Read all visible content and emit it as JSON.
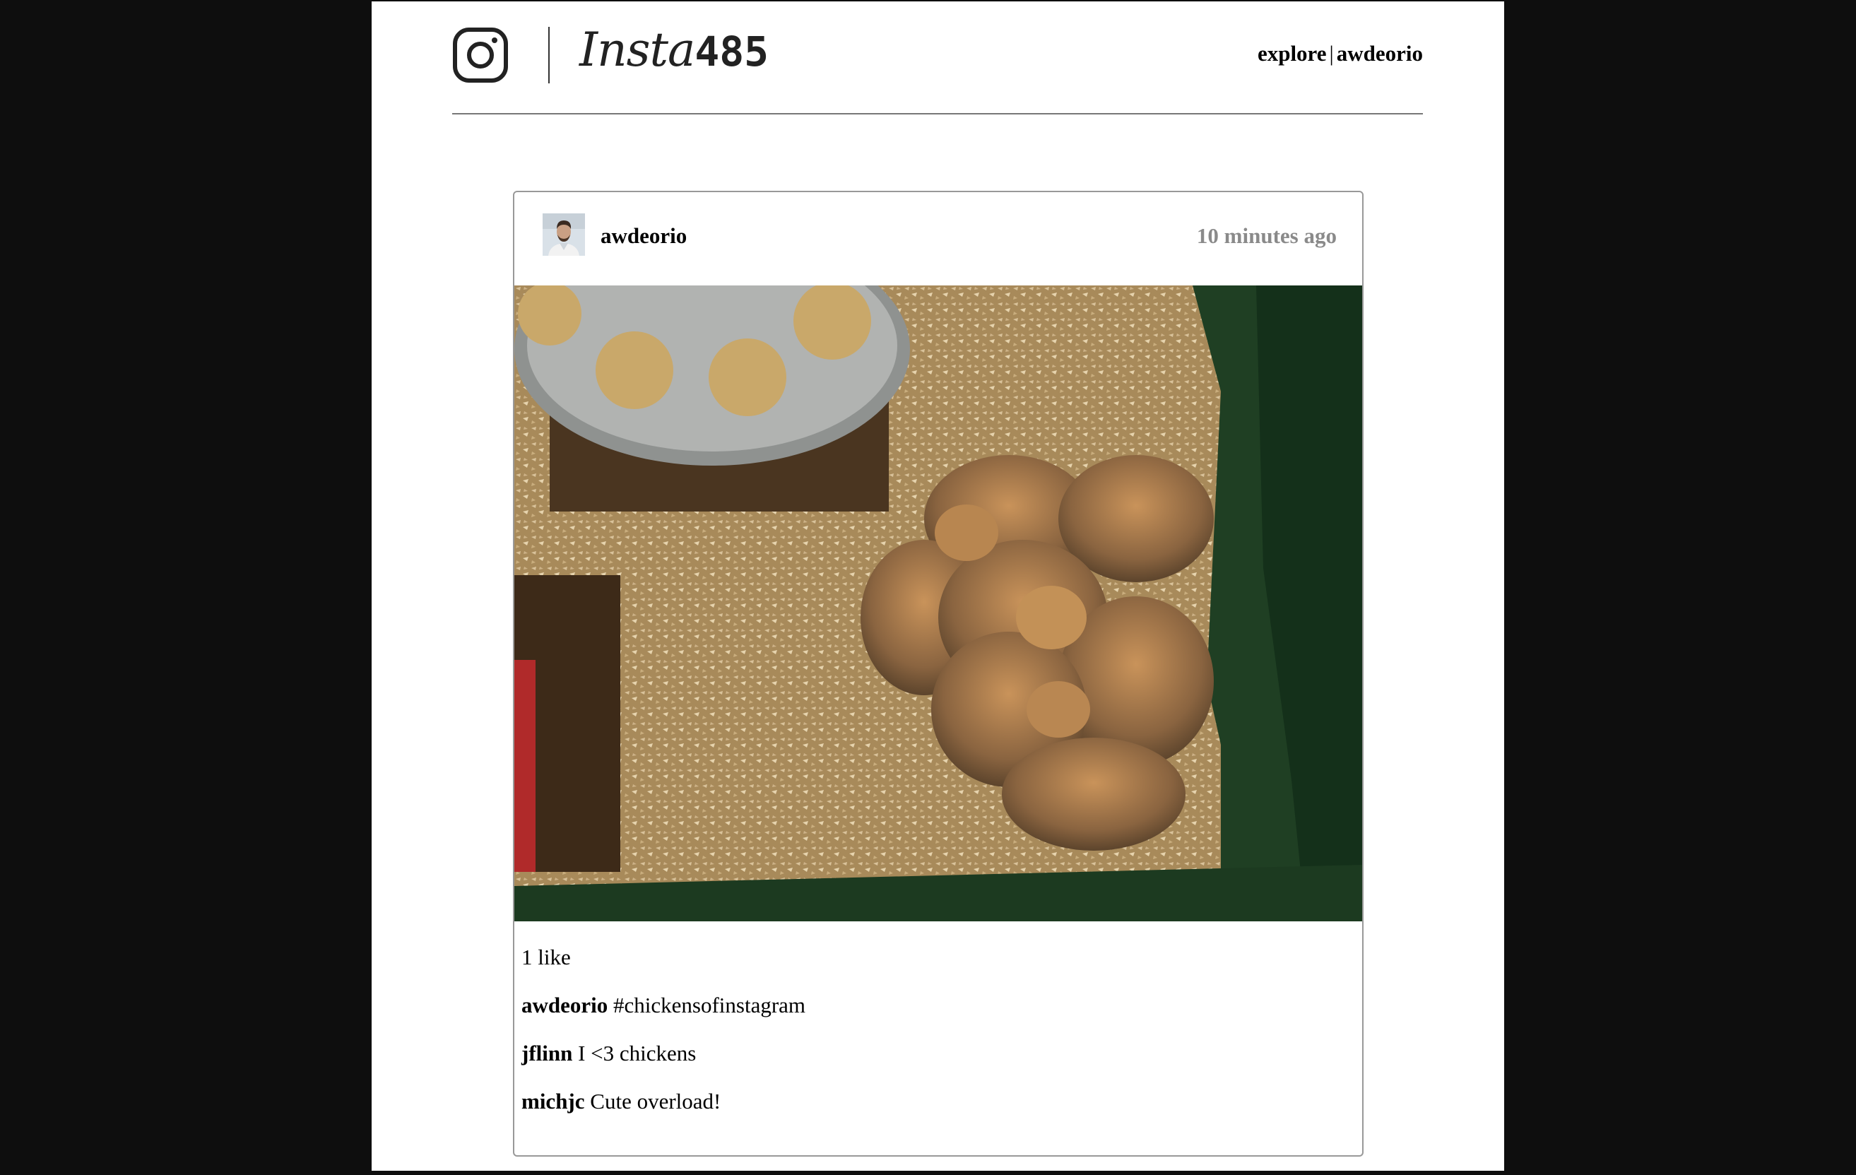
{
  "brand": {
    "wordmark_script": "Insta",
    "wordmark_number": "485",
    "logo_icon": "instagram-camera-icon"
  },
  "nav": {
    "explore_label": "explore",
    "separator": "|",
    "user_label": "awdeorio"
  },
  "post": {
    "owner": "awdeorio",
    "timestamp": "10 minutes ago",
    "likes_text": "1 like",
    "image_subject": "chicks in sawdust brooder",
    "comments": [
      {
        "user": "awdeorio",
        "text": "#chickensofinstagram"
      },
      {
        "user": "jflinn",
        "text": "I <3 chickens"
      },
      {
        "user": "michjc",
        "text": "Cute overload!"
      }
    ]
  },
  "colors": {
    "background": "#0e0e0e",
    "page": "#ffffff",
    "timestamp": "#8a8a8a",
    "border": "#999999"
  }
}
